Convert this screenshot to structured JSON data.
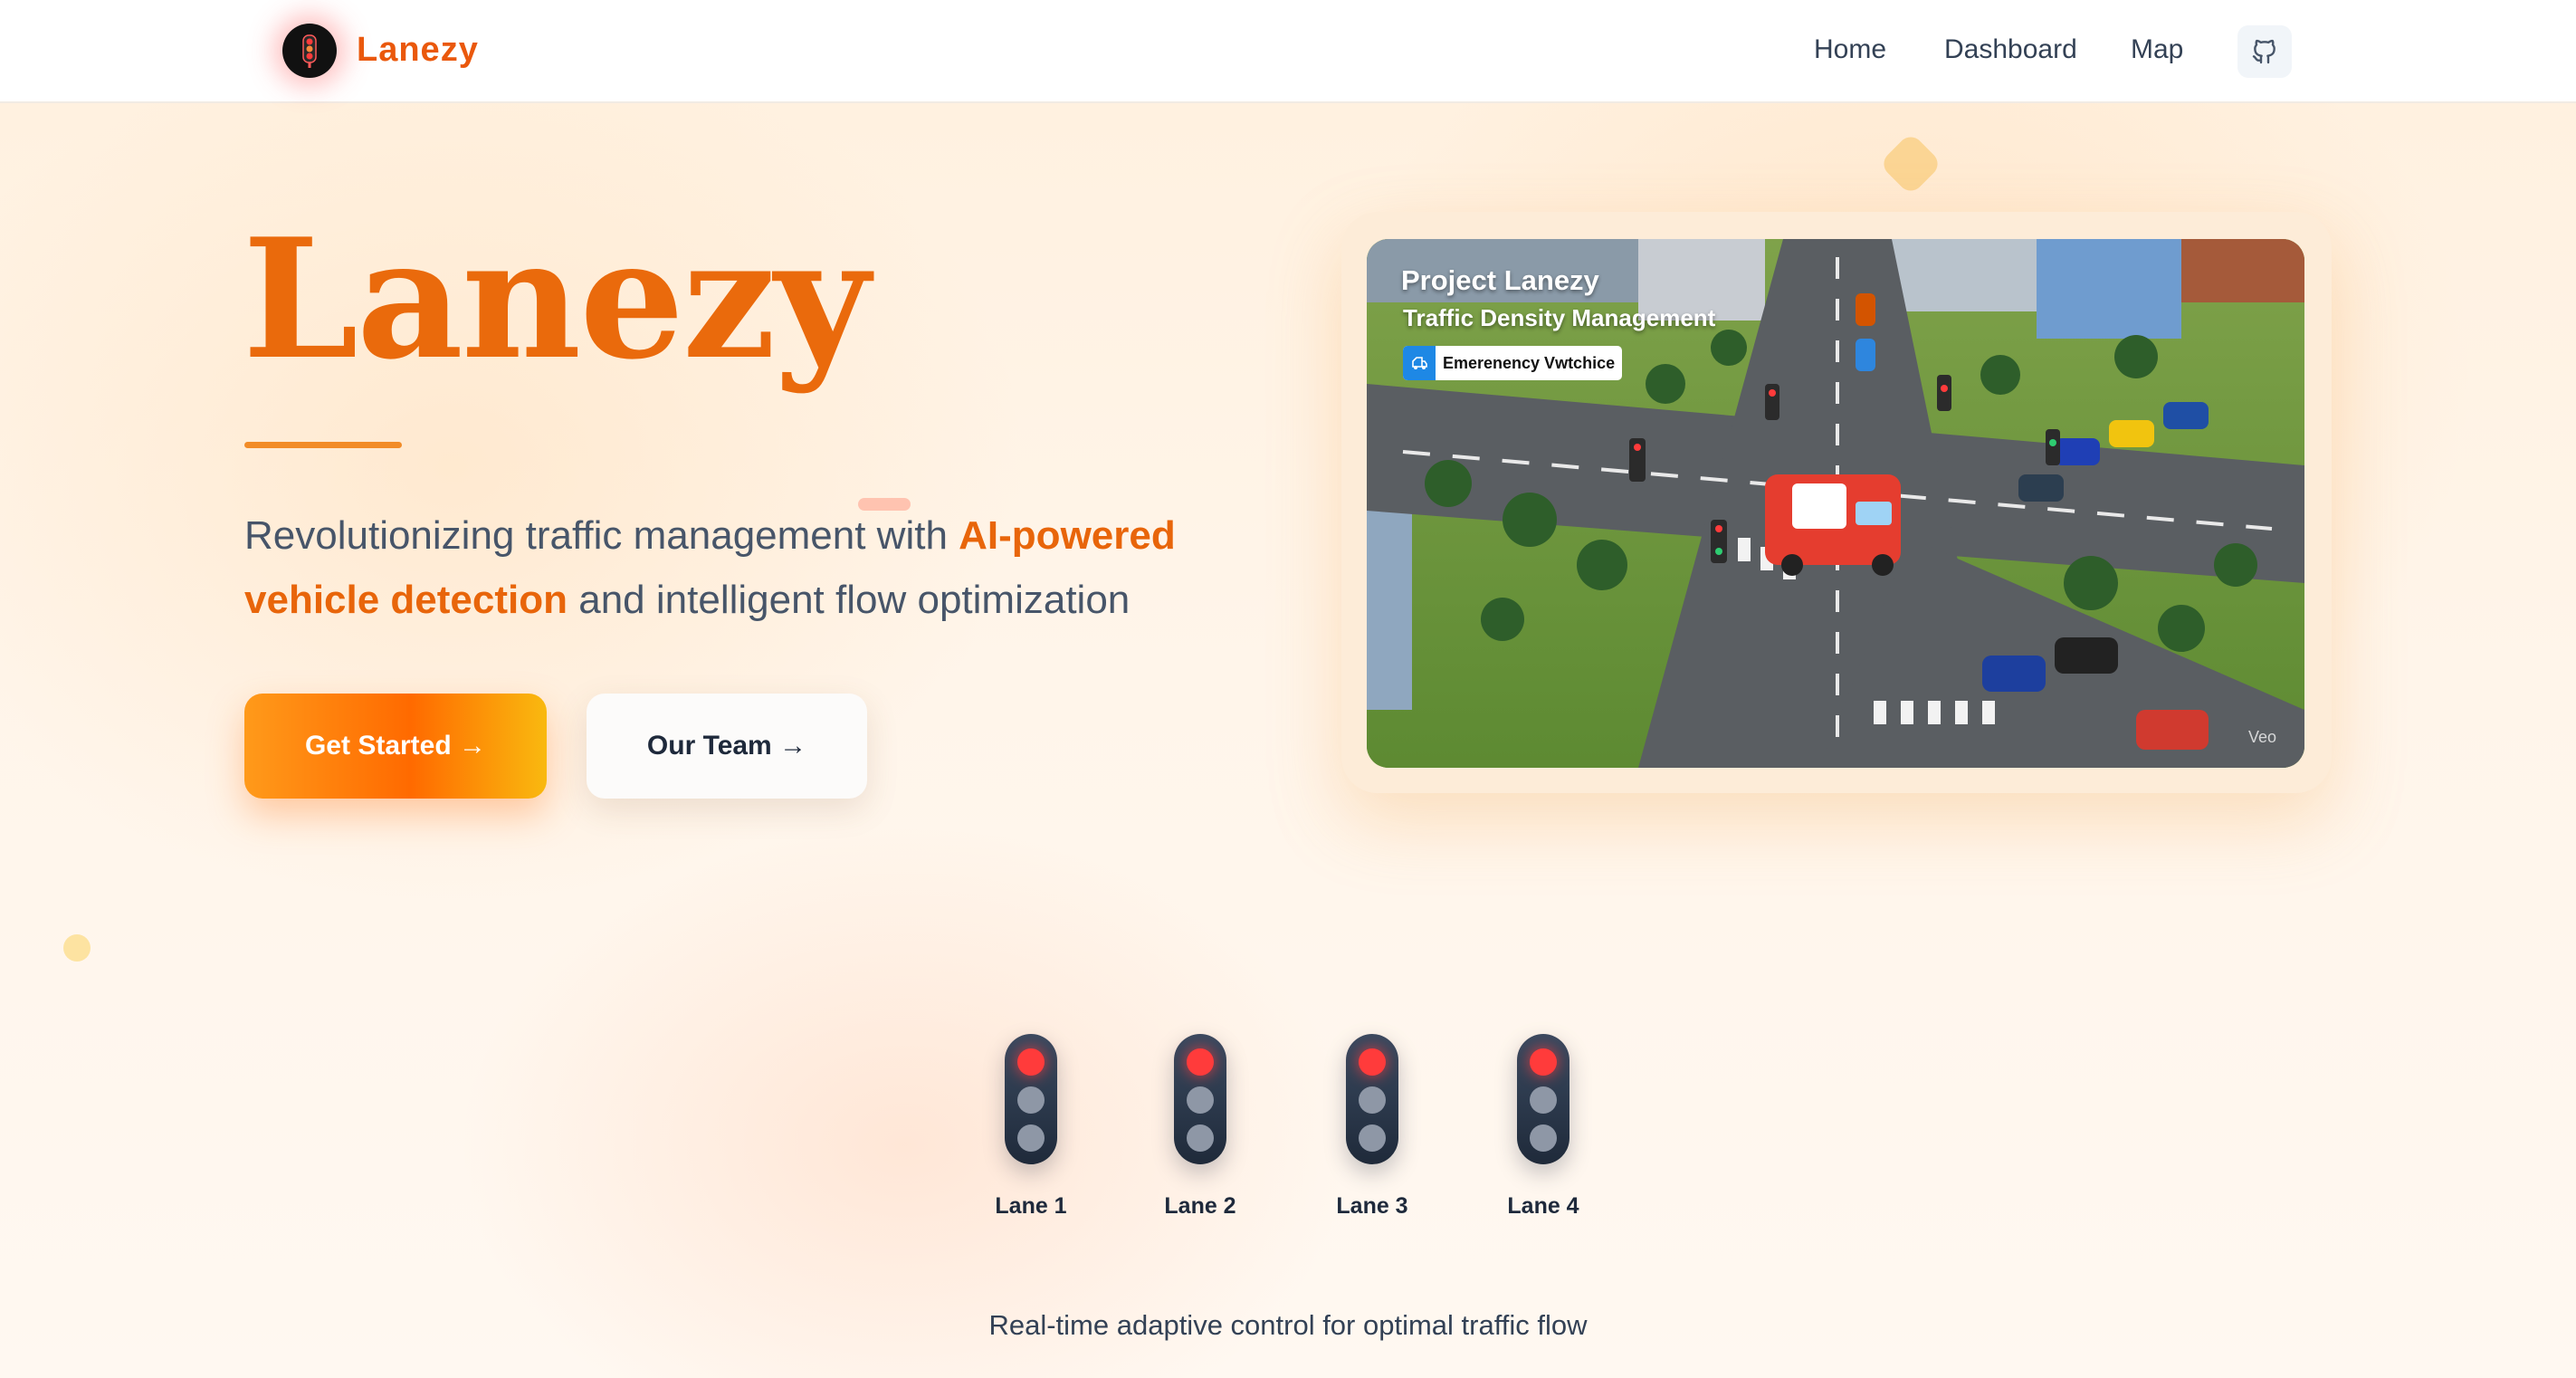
{
  "navbar": {
    "brand": "Lanezy",
    "links": [
      "Home",
      "Dashboard",
      "Map"
    ],
    "github_icon": "github-icon"
  },
  "hero": {
    "title": "Lanezy",
    "tagline": {
      "part1": "Revolutionizing traffic management with ",
      "highlight": "AI-powered vehicle detection",
      "part2": " and intelligent flow optimization"
    },
    "primary_button": "Get Started →",
    "secondary_button": "Our Team →"
  },
  "video": {
    "title": "Project Lanezy",
    "subtitle": "Traffic Density Management",
    "badge": "Emerenency Vwtchice",
    "watermark": "Veo"
  },
  "lanes": {
    "items": [
      {
        "label": "Lane 1",
        "state": "red"
      },
      {
        "label": "Lane 2",
        "state": "red"
      },
      {
        "label": "Lane 3",
        "state": "red"
      },
      {
        "label": "Lane 4",
        "state": "red"
      }
    ],
    "caption": "Real-time adaptive control for optimal traffic flow"
  },
  "colors": {
    "accent": "#ea580c",
    "primary_button_start": "#ff9a1a",
    "primary_button_end": "#f9b90f",
    "signal_red": "#ff3b3b"
  }
}
